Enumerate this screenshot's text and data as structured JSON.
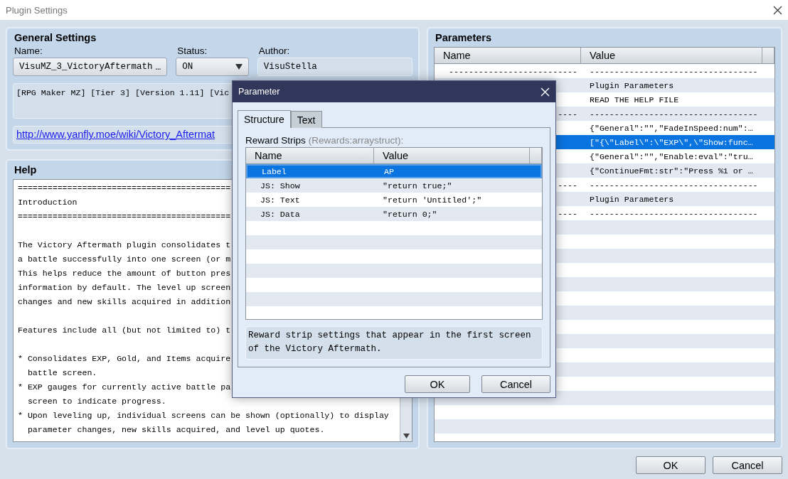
{
  "window": {
    "title": "Plugin Settings"
  },
  "general": {
    "title": "General Settings",
    "name": {
      "label": "Name:",
      "value": "VisuMZ_3_VictoryAftermath",
      "button": "…"
    },
    "status": {
      "label": "Status:",
      "value": "ON"
    },
    "author": {
      "label": "Author:",
      "value": "VisuStella"
    },
    "description": "[RPG Maker MZ] [Tier 3] [Version 1.11] [Vic",
    "link": "http://www.yanfly.moe/wiki/Victory_Aftermat"
  },
  "help": {
    "title": "Help",
    "blocks": [
      [
        "===========================================",
        "Introduction",
        "==========================================="
      ],
      [
        "The Victory Aftermath plugin consolidates t",
        "a battle successfully into one screen (or m",
        "This helps reduce the amount of button pres",
        "information by default. The level up screen",
        "changes and new skills acquired in addition"
      ],
      [
        "Features include all (but not limited to) t"
      ],
      [
        "* Consolidates EXP, Gold, and Items acquire",
        "  battle screen.",
        "* EXP gauges for currently active battle pa",
        "  screen to indicate progress.",
        "* Upon leveling up, individual screens can be shown (optionally) to display",
        "  parameter changes, new skills acquired, and level up quotes."
      ]
    ]
  },
  "parameters": {
    "title": "Parameters",
    "columns": [
      "Name",
      "Value"
    ],
    "rows": [
      {
        "name": "--------------------------",
        "value": "----------------------------------",
        "selected": false
      },
      {
        "value": "Plugin Parameters",
        "selected": false
      },
      {
        "value": "READ THE HELP FILE",
        "selected": false
      },
      {
        "name": "----",
        "value": "----------------------------------",
        "selected": false
      },
      {
        "value": "{\"General\":\"\",\"FadeInSpeed:num\":…",
        "selected": false
      },
      {
        "value": "[\"{\\\"Label\\\":\\\"EXP\\\",\\\"Show:func…",
        "selected": true
      },
      {
        "value": "{\"General\":\"\",\"Enable:eval\":\"tru…",
        "selected": false
      },
      {
        "value": "{\"ContinueFmt:str\":\"Press %1 or …",
        "selected": false
      },
      {
        "name": "----",
        "value": "----------------------------------",
        "selected": false
      },
      {
        "value": "Plugin Parameters",
        "selected": false
      },
      {
        "name": "----",
        "value": "----------------------------------",
        "selected": false
      }
    ]
  },
  "dialog": {
    "title": "Parameter",
    "tabs": [
      {
        "label": "Structure",
        "selected": true
      },
      {
        "label": "Text",
        "selected": false
      }
    ],
    "field_label": "Reward Strips",
    "field_key": "(Rewards:arraystruct):",
    "columns": [
      "Name",
      "Value"
    ],
    "rows": [
      {
        "name": "Label",
        "value": "AP",
        "selected": true
      },
      {
        "name": "JS: Show",
        "value": "\"return true;\"",
        "selected": false
      },
      {
        "name": "JS: Text",
        "value": "\"return 'Untitled';\"",
        "selected": false
      },
      {
        "name": "JS: Data",
        "value": "\"return 0;\"",
        "selected": false
      }
    ],
    "description": "Reward strip settings that appear in the first screen of the Victory Aftermath.",
    "buttons": [
      "OK",
      "Cancel"
    ]
  },
  "buttons": [
    "OK",
    "Cancel"
  ]
}
